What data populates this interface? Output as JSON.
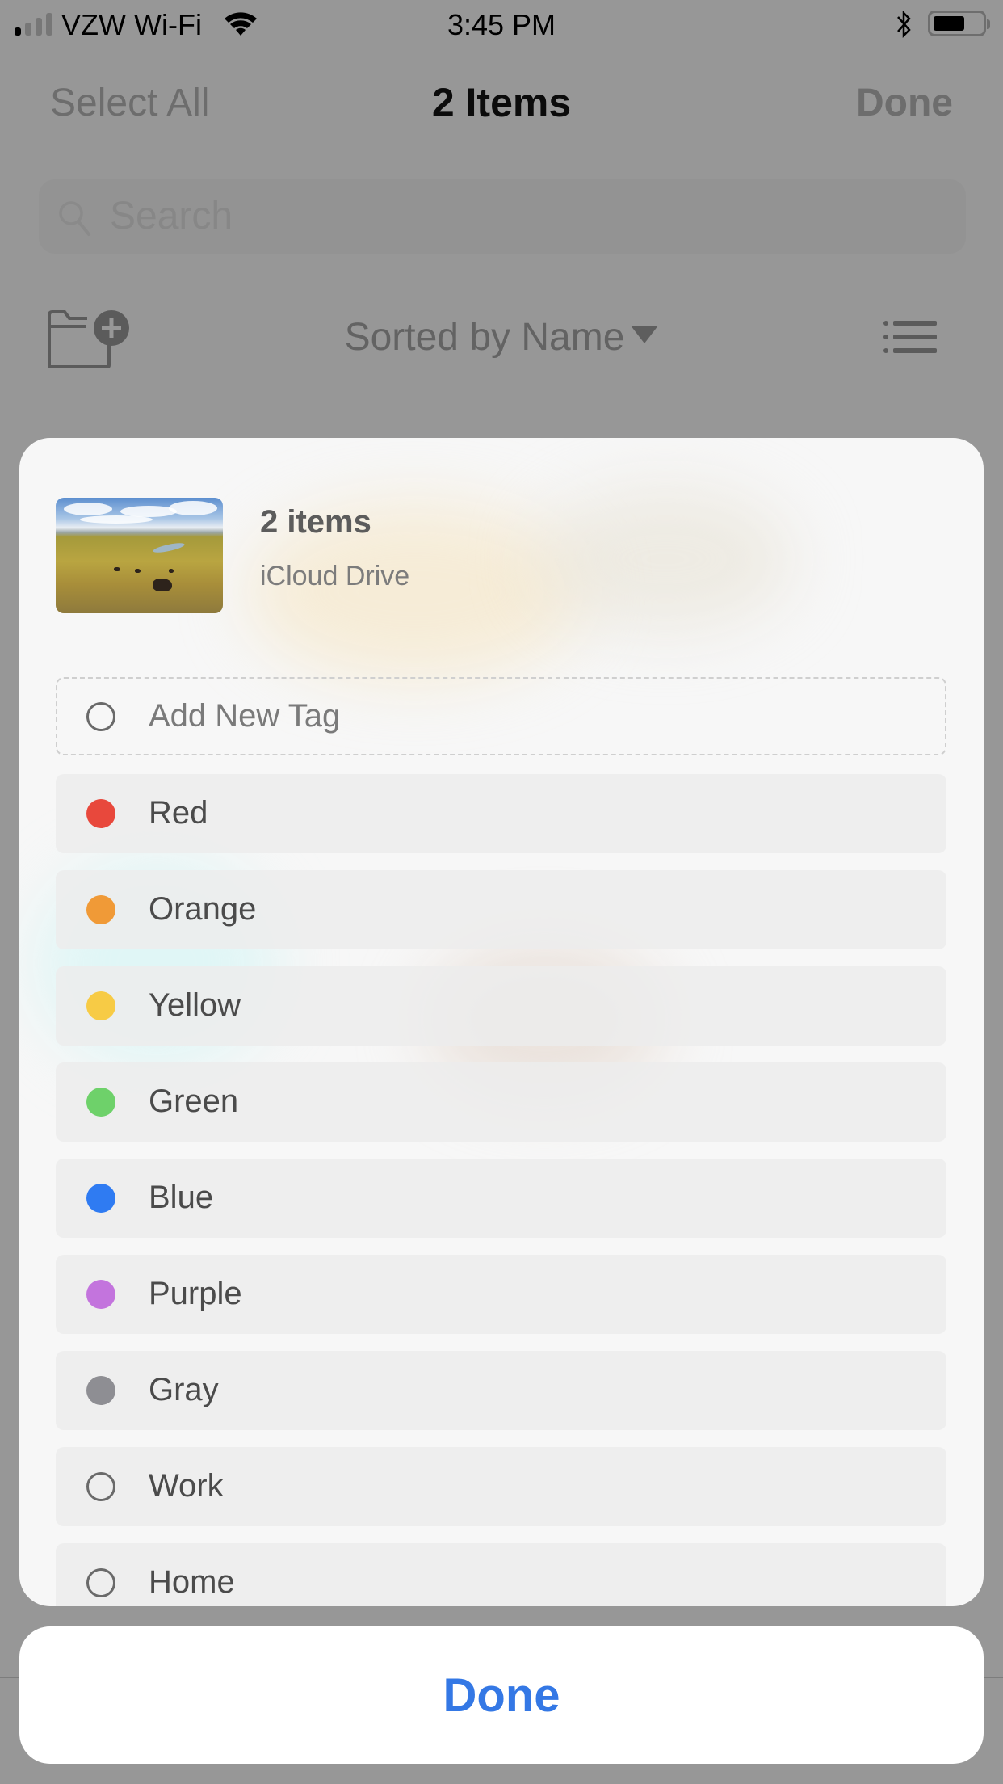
{
  "status_bar": {
    "carrier": "VZW Wi-Fi",
    "time": "3:45 PM",
    "signal_bars_filled": 1,
    "signal_bars_total": 4,
    "battery_level": 0.65,
    "icons": [
      "signal-icon",
      "wifi-icon",
      "bluetooth-icon",
      "battery-icon"
    ]
  },
  "nav": {
    "left_button": "Select All",
    "title": "2 Items",
    "right_button": "Done"
  },
  "search": {
    "placeholder": "Search"
  },
  "toolbar": {
    "new_folder_icon": "folder-plus-icon",
    "sort_label": "Sorted by Name",
    "view_icon": "list-view-icon"
  },
  "sheet": {
    "title": "2 items",
    "subtitle": "iCloud Drive",
    "add_tag_label": "Add New Tag",
    "tags": [
      {
        "label": "Red",
        "color": "#e8483c"
      },
      {
        "label": "Orange",
        "color": "#f09a37"
      },
      {
        "label": "Yellow",
        "color": "#f7cb45"
      },
      {
        "label": "Green",
        "color": "#6ed16a"
      },
      {
        "label": "Blue",
        "color": "#2f7bf2"
      },
      {
        "label": "Purple",
        "color": "#c374dd"
      },
      {
        "label": "Gray",
        "color": "#8e8e93"
      },
      {
        "label": "Work",
        "color": null
      },
      {
        "label": "Home",
        "color": null
      }
    ]
  },
  "done_button": {
    "label": "Done",
    "color": "#3478e5"
  }
}
